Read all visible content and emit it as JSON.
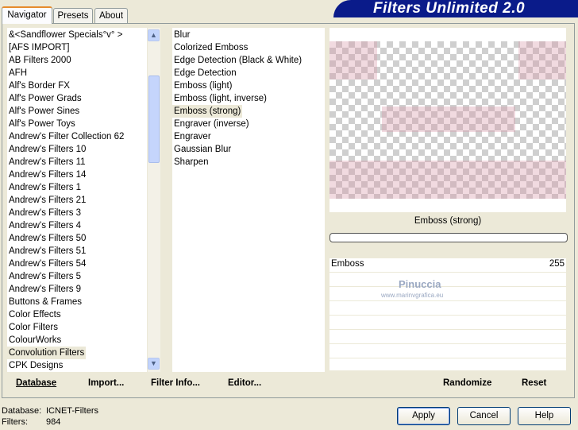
{
  "tabs": [
    {
      "label": "Navigator"
    },
    {
      "label": "Presets"
    },
    {
      "label": "About"
    }
  ],
  "banner": "Filters Unlimited 2.0",
  "categories": [
    "&<Sandflower Specials°v° >",
    "[AFS IMPORT]",
    "AB Filters 2000",
    "AFH",
    "Alf's Border FX",
    "Alf's Power Grads",
    "Alf's Power Sines",
    "Alf's Power Toys",
    "Andrew's Filter Collection 62",
    "Andrew's Filters 10",
    "Andrew's Filters 11",
    "Andrew's Filters 14",
    "Andrew's Filters 1",
    "Andrew's Filters 21",
    "Andrew's Filters 3",
    "Andrew's Filters 4",
    "Andrew's Filters 50",
    "Andrew's Filters 51",
    "Andrew's Filters 54",
    "Andrew's Filters 5",
    "Andrew's Filters 9",
    "Buttons & Frames",
    "Color Effects",
    "Color Filters",
    "ColourWorks",
    "Convolution Filters",
    "CPK Designs"
  ],
  "selected_category": "Convolution Filters",
  "filters": [
    "Blur",
    "Colorized Emboss",
    "Edge Detection (Black & White)",
    "Edge Detection",
    "Emboss (light)",
    "Emboss (light, inverse)",
    "Emboss (strong)",
    "Engraver (inverse)",
    "Engraver",
    "Gaussian Blur",
    "Sharpen"
  ],
  "selected_filter": "Emboss (strong)",
  "preview": {
    "filter_name": "Emboss (strong)"
  },
  "params": [
    {
      "name": "Emboss",
      "value": "255"
    }
  ],
  "watermark": {
    "name": "Pinuccia",
    "site": "www.marinvgrafica.eu"
  },
  "bottom_left": {
    "database": "Database",
    "import": "Import...",
    "filter_info": "Filter Info...",
    "editor": "Editor..."
  },
  "bottom_right": {
    "randomize": "Randomize",
    "reset": "Reset"
  },
  "status": {
    "db_label": "Database:",
    "db_value": "ICNET-Filters",
    "filters_label": "Filters:",
    "filters_value": "984"
  },
  "buttons": {
    "apply": "Apply",
    "cancel": "Cancel",
    "help": "Help"
  }
}
